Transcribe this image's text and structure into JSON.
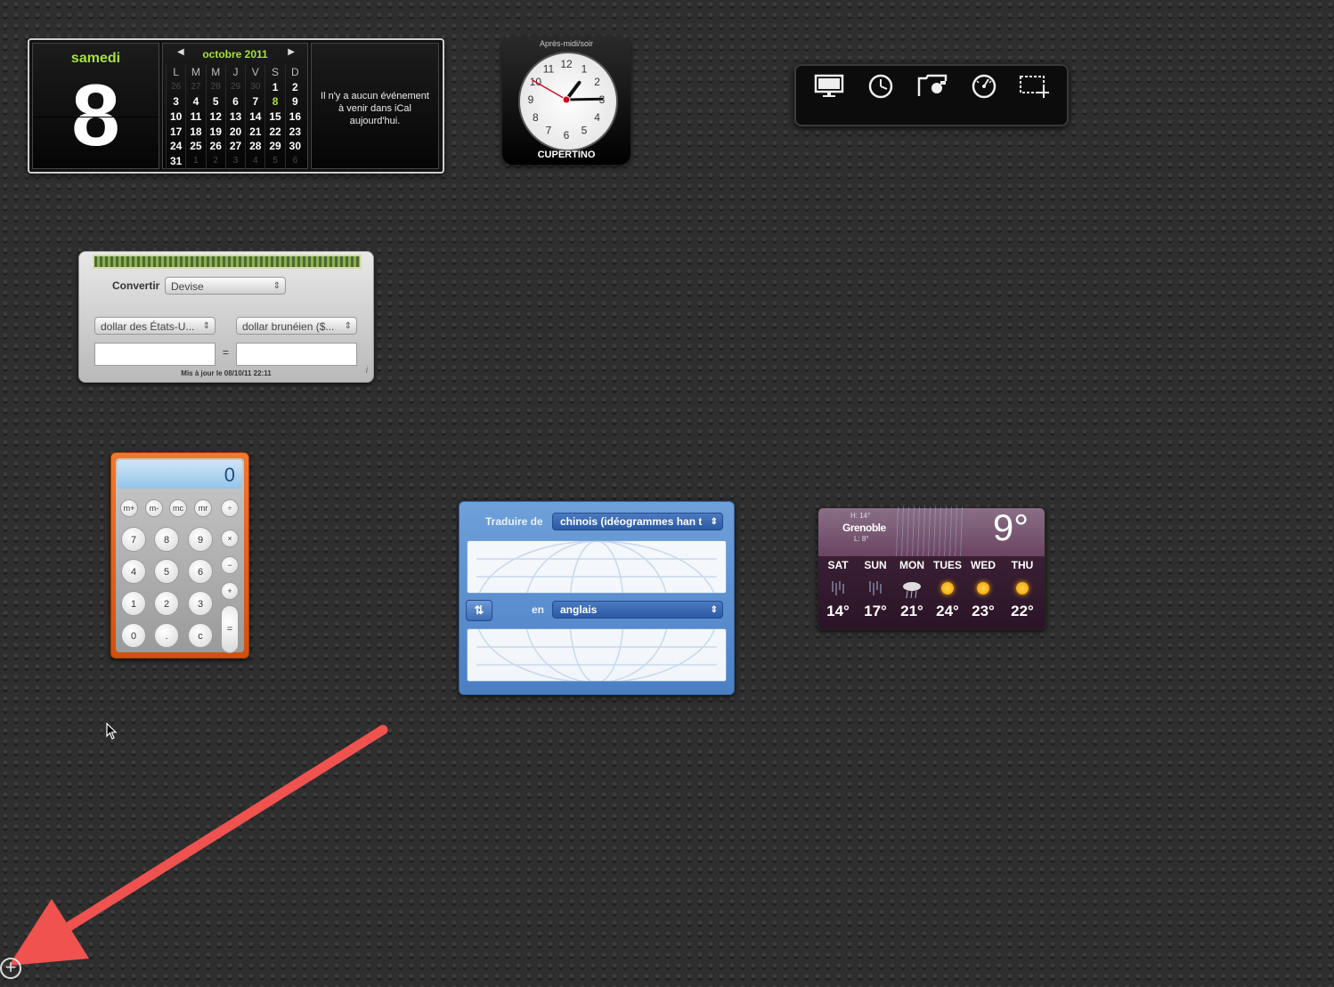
{
  "calendar": {
    "day_name": "samedi",
    "day_number": "8",
    "month_title": "octobre 2011",
    "weekday_headers": [
      "L",
      "M",
      "M",
      "J",
      "V",
      "S",
      "D"
    ],
    "weeks": [
      [
        {
          "d": "26",
          "dim": true
        },
        {
          "d": "27",
          "dim": true
        },
        {
          "d": "28",
          "dim": true
        },
        {
          "d": "29",
          "dim": true
        },
        {
          "d": "30",
          "dim": true
        },
        {
          "d": "1"
        },
        {
          "d": "2"
        }
      ],
      [
        {
          "d": "3"
        },
        {
          "d": "4"
        },
        {
          "d": "5"
        },
        {
          "d": "6"
        },
        {
          "d": "7"
        },
        {
          "d": "8",
          "today": true
        },
        {
          "d": "9"
        }
      ],
      [
        {
          "d": "10"
        },
        {
          "d": "11"
        },
        {
          "d": "12"
        },
        {
          "d": "13"
        },
        {
          "d": "14"
        },
        {
          "d": "15"
        },
        {
          "d": "16"
        }
      ],
      [
        {
          "d": "17"
        },
        {
          "d": "18"
        },
        {
          "d": "19"
        },
        {
          "d": "20"
        },
        {
          "d": "21"
        },
        {
          "d": "22"
        },
        {
          "d": "23"
        }
      ],
      [
        {
          "d": "24"
        },
        {
          "d": "25"
        },
        {
          "d": "26"
        },
        {
          "d": "27"
        },
        {
          "d": "28"
        },
        {
          "d": "29"
        },
        {
          "d": "30"
        }
      ],
      [
        {
          "d": "31"
        },
        {
          "d": "1",
          "dim": true
        },
        {
          "d": "2",
          "dim": true
        },
        {
          "d": "3",
          "dim": true
        },
        {
          "d": "4",
          "dim": true
        },
        {
          "d": "5",
          "dim": true
        },
        {
          "d": "6",
          "dim": true
        }
      ]
    ],
    "events_text": "Il n'y a aucun événement à venir dans iCal aujourd'hui."
  },
  "clock": {
    "period_label": "Après-midi/soir",
    "city": "CUPERTINO",
    "hour": 1,
    "minute": 14,
    "second": 50,
    "numbers": [
      "12",
      "1",
      "2",
      "3",
      "4",
      "5",
      "6",
      "7",
      "8",
      "9",
      "10",
      "11"
    ]
  },
  "toolbar": {
    "icons": [
      "display-icon",
      "clock-icon",
      "folder-camera-icon",
      "gauge-icon",
      "selection-icon"
    ]
  },
  "converter": {
    "convert_label": "Convertir",
    "category_value": "Devise",
    "from_currency": "dollar des États-U...",
    "to_currency": "dollar brunéien ($...",
    "from_amount": "",
    "to_amount": "",
    "equals": "=",
    "updated": "Mis à jour le 08/10/11 22:11",
    "info": "i"
  },
  "calculator": {
    "display": "0",
    "memory_keys": [
      "m+",
      "m-",
      "mc",
      "mr"
    ],
    "op_divide": "÷",
    "op_multiply": "×",
    "op_minus": "−",
    "op_plus": "+",
    "op_equals": "=",
    "rows": [
      [
        "7",
        "8",
        "9"
      ],
      [
        "4",
        "5",
        "6"
      ],
      [
        "1",
        "2",
        "3"
      ],
      [
        "0",
        ".",
        "c"
      ]
    ]
  },
  "translator": {
    "from_label": "Traduire de",
    "from_language": "chinois (idéogrammes han t",
    "to_label": "en",
    "to_language": "anglais",
    "swap_label": "⇅"
  },
  "weather": {
    "high": "H: 14°",
    "city": "Grenoble",
    "low": "L: 8°",
    "current_temp": "9°",
    "days": [
      {
        "name": "SAT",
        "temp": "14°",
        "icon": "rain"
      },
      {
        "name": "SUN",
        "temp": "17°",
        "icon": "rain"
      },
      {
        "name": "MON",
        "temp": "21°",
        "icon": "cloud-rain"
      },
      {
        "name": "TUES",
        "temp": "24°",
        "icon": "sun"
      },
      {
        "name": "WED",
        "temp": "23°",
        "icon": "sun"
      },
      {
        "name": "THU",
        "temp": "22°",
        "icon": "sun"
      }
    ]
  },
  "dashboard": {
    "add_widget_symbol": "+",
    "annotation_color": "#f0524f"
  }
}
